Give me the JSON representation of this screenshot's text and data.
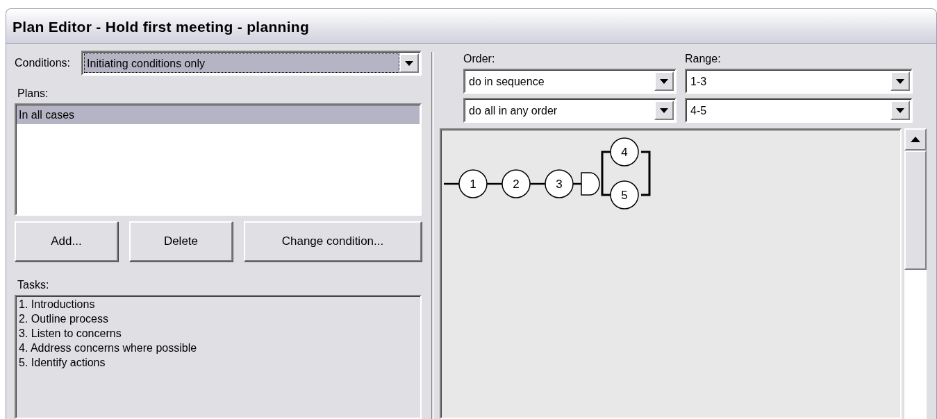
{
  "window": {
    "title": "Plan Editor - Hold first meeting - planning"
  },
  "conditions": {
    "label": "Conditions:",
    "value": "Initiating conditions only",
    "focused": true
  },
  "plans": {
    "label": "Plans:",
    "items": [
      {
        "text": "In all cases",
        "selected": true
      }
    ]
  },
  "buttons": [
    "Add...",
    "Delete",
    "Change condition..."
  ],
  "tasks": {
    "label": "Tasks:",
    "disabled": true,
    "items": [
      {
        "text": "1. Introductions"
      },
      {
        "text": "2. Outline process"
      },
      {
        "text": "3. Listen to concerns"
      },
      {
        "text": "4. Address concerns where possible"
      },
      {
        "text": "5. Identify actions"
      }
    ]
  },
  "order_label": "Order:",
  "range_label": "Range:",
  "rules": [
    {
      "order": "do in sequence",
      "range": "1-3"
    },
    {
      "order": "do all in any order",
      "range": "4-5"
    }
  ],
  "diagram": {
    "sequence": [
      {
        "kind": "node",
        "label": "1"
      },
      {
        "kind": "node",
        "label": "2"
      },
      {
        "kind": "node",
        "label": "3"
      },
      {
        "kind": "parallel",
        "children": [
          {
            "kind": "node",
            "label": "4"
          },
          {
            "kind": "node",
            "label": "5"
          }
        ]
      }
    ]
  }
}
